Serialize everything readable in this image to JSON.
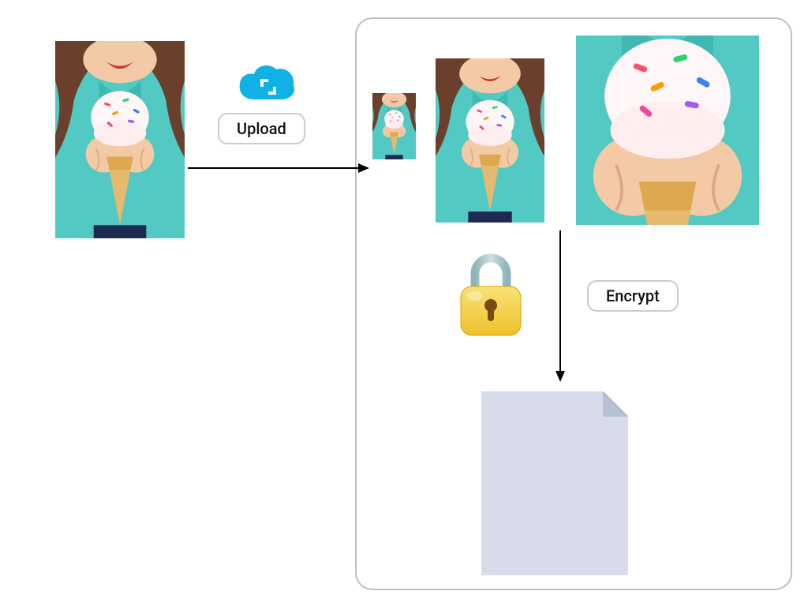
{
  "labels": {
    "upload": "Upload",
    "encrypt": "Encrypt"
  },
  "icons": {
    "cloud": "cloud-crop-icon",
    "lock": "lock-icon",
    "file": "document-page-icon",
    "arrow_right": "arrow-right-icon",
    "arrow_down": "arrow-down-icon"
  },
  "colors": {
    "cloud": "#10b2e6",
    "lock_body": "#f3cf3e",
    "lock_shackle": "#a8c3ca",
    "file_fill": "#d7dbea",
    "border": "#bfbfbf"
  },
  "images": {
    "subject": "child-with-ice-cream-cone-photo",
    "variants": [
      "source",
      "thumbnail-small",
      "thumbnail-medium",
      "thumbnail-large"
    ]
  },
  "flow": {
    "steps": [
      {
        "action": "Upload",
        "from": "source-image",
        "to": "resized-variants"
      },
      {
        "action": "Encrypt",
        "from": "resized-variants",
        "to": "encrypted-file"
      }
    ]
  }
}
